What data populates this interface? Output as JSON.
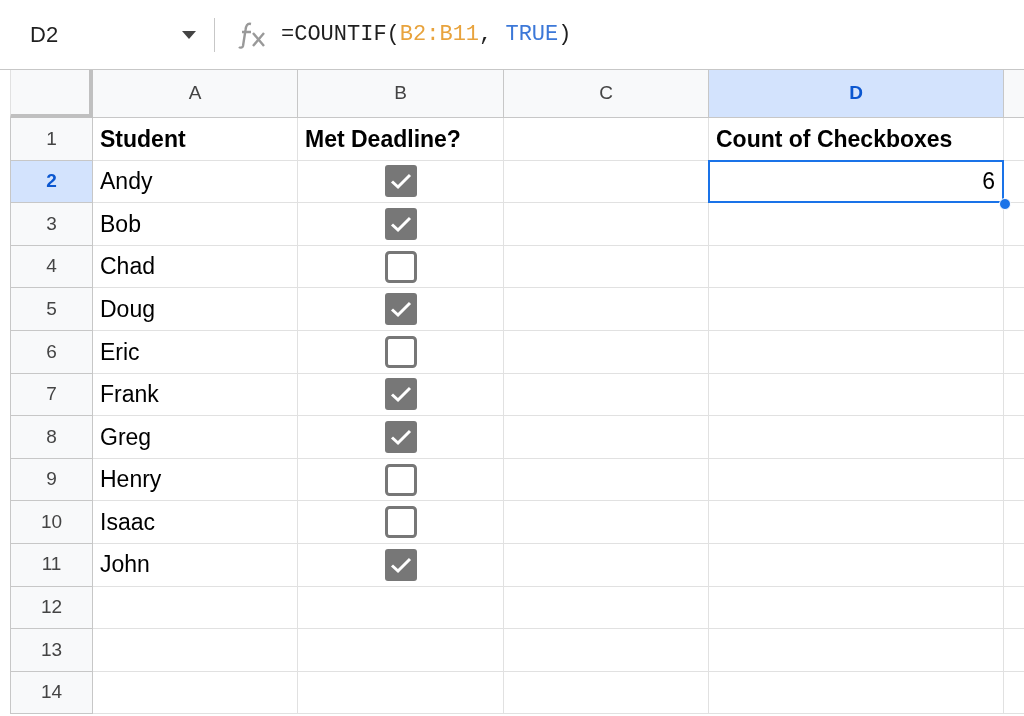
{
  "name_box": {
    "value": "D2"
  },
  "formula_bar": {
    "tokens": [
      {
        "text": "=COUNTIF(",
        "color": "#1f1f1f"
      },
      {
        "text": "B2:B11",
        "color": "#e8a33d"
      },
      {
        "text": ", ",
        "color": "#1f1f1f"
      },
      {
        "text": "TRUE",
        "color": "#3c78d8"
      },
      {
        "text": ")",
        "color": "#1f1f1f"
      }
    ]
  },
  "columns": [
    {
      "label": "A",
      "selected": false
    },
    {
      "label": "B",
      "selected": false
    },
    {
      "label": "C",
      "selected": false
    },
    {
      "label": "D",
      "selected": true
    }
  ],
  "rows": [
    {
      "number": "1",
      "selected": false,
      "cells": [
        {
          "kind": "text",
          "text": "Student",
          "bold": true
        },
        {
          "kind": "text",
          "text": "Met Deadline?",
          "bold": true
        },
        {
          "kind": "empty"
        },
        {
          "kind": "text",
          "text": "Count of Checkboxes",
          "bold": true
        }
      ]
    },
    {
      "number": "2",
      "selected": true,
      "cells": [
        {
          "kind": "text",
          "text": "Andy",
          "bold": false
        },
        {
          "kind": "checkbox",
          "checked": true
        },
        {
          "kind": "empty"
        },
        {
          "kind": "number",
          "text": "6",
          "selected": true
        }
      ]
    },
    {
      "number": "3",
      "selected": false,
      "cells": [
        {
          "kind": "text",
          "text": "Bob",
          "bold": false
        },
        {
          "kind": "checkbox",
          "checked": true
        },
        {
          "kind": "empty"
        },
        {
          "kind": "empty"
        }
      ]
    },
    {
      "number": "4",
      "selected": false,
      "cells": [
        {
          "kind": "text",
          "text": "Chad",
          "bold": false
        },
        {
          "kind": "checkbox",
          "checked": false
        },
        {
          "kind": "empty"
        },
        {
          "kind": "empty"
        }
      ]
    },
    {
      "number": "5",
      "selected": false,
      "cells": [
        {
          "kind": "text",
          "text": "Doug",
          "bold": false
        },
        {
          "kind": "checkbox",
          "checked": true
        },
        {
          "kind": "empty"
        },
        {
          "kind": "empty"
        }
      ]
    },
    {
      "number": "6",
      "selected": false,
      "cells": [
        {
          "kind": "text",
          "text": "Eric",
          "bold": false
        },
        {
          "kind": "checkbox",
          "checked": false
        },
        {
          "kind": "empty"
        },
        {
          "kind": "empty"
        }
      ]
    },
    {
      "number": "7",
      "selected": false,
      "cells": [
        {
          "kind": "text",
          "text": "Frank",
          "bold": false
        },
        {
          "kind": "checkbox",
          "checked": true
        },
        {
          "kind": "empty"
        },
        {
          "kind": "empty"
        }
      ]
    },
    {
      "number": "8",
      "selected": false,
      "cells": [
        {
          "kind": "text",
          "text": "Greg",
          "bold": false
        },
        {
          "kind": "checkbox",
          "checked": true
        },
        {
          "kind": "empty"
        },
        {
          "kind": "empty"
        }
      ]
    },
    {
      "number": "9",
      "selected": false,
      "cells": [
        {
          "kind": "text",
          "text": "Henry",
          "bold": false
        },
        {
          "kind": "checkbox",
          "checked": false
        },
        {
          "kind": "empty"
        },
        {
          "kind": "empty"
        }
      ]
    },
    {
      "number": "10",
      "selected": false,
      "cells": [
        {
          "kind": "text",
          "text": "Isaac",
          "bold": false
        },
        {
          "kind": "checkbox",
          "checked": false
        },
        {
          "kind": "empty"
        },
        {
          "kind": "empty"
        }
      ]
    },
    {
      "number": "11",
      "selected": false,
      "cells": [
        {
          "kind": "text",
          "text": "John",
          "bold": false
        },
        {
          "kind": "checkbox",
          "checked": true
        },
        {
          "kind": "empty"
        },
        {
          "kind": "empty"
        }
      ]
    },
    {
      "number": "12",
      "selected": false,
      "cells": [
        {
          "kind": "empty"
        },
        {
          "kind": "empty"
        },
        {
          "kind": "empty"
        },
        {
          "kind": "empty"
        }
      ]
    },
    {
      "number": "13",
      "selected": false,
      "cells": [
        {
          "kind": "empty"
        },
        {
          "kind": "empty"
        },
        {
          "kind": "empty"
        },
        {
          "kind": "empty"
        }
      ]
    },
    {
      "number": "14",
      "selected": false,
      "cells": [
        {
          "kind": "empty"
        },
        {
          "kind": "empty"
        },
        {
          "kind": "empty"
        },
        {
          "kind": "empty"
        }
      ]
    }
  ]
}
